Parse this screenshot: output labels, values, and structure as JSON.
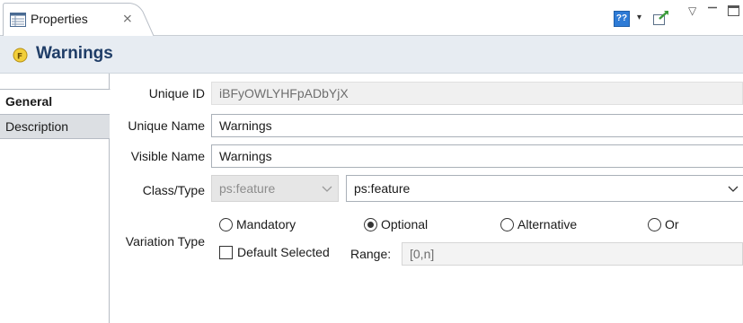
{
  "tab": {
    "title": "Properties",
    "close_glyph": "⨯"
  },
  "toolbar": {
    "help_label": "??",
    "dropdown_glyph": "▾",
    "menu_glyph": "▽"
  },
  "header": {
    "title": "Warnings"
  },
  "side_tabs": [
    {
      "label": "General",
      "selected": true
    },
    {
      "label": "Description",
      "selected": false
    }
  ],
  "form": {
    "unique_id": {
      "label": "Unique ID",
      "value": "iBFyOWLYHFpADbYjX"
    },
    "unique_name": {
      "label": "Unique Name",
      "value": "Warnings"
    },
    "visible_name": {
      "label": "Visible Name",
      "value": "Warnings"
    },
    "class_type": {
      "label": "Class/Type",
      "class_value": "ps:feature",
      "type_value": "ps:feature"
    },
    "variation_type": {
      "label": "Variation Type",
      "options": [
        {
          "label": "Mandatory",
          "selected": false
        },
        {
          "label": "Optional",
          "selected": true
        },
        {
          "label": "Alternative",
          "selected": false
        },
        {
          "label": "Or",
          "selected": false
        }
      ],
      "default_selected": {
        "label": "Default Selected",
        "checked": false
      },
      "range": {
        "label": "Range:",
        "value": "[0,n]"
      }
    }
  },
  "colors": {
    "header_bg": "#e7ecf2",
    "header_title": "#1f3d67",
    "help_blue": "#2e7bd6"
  }
}
